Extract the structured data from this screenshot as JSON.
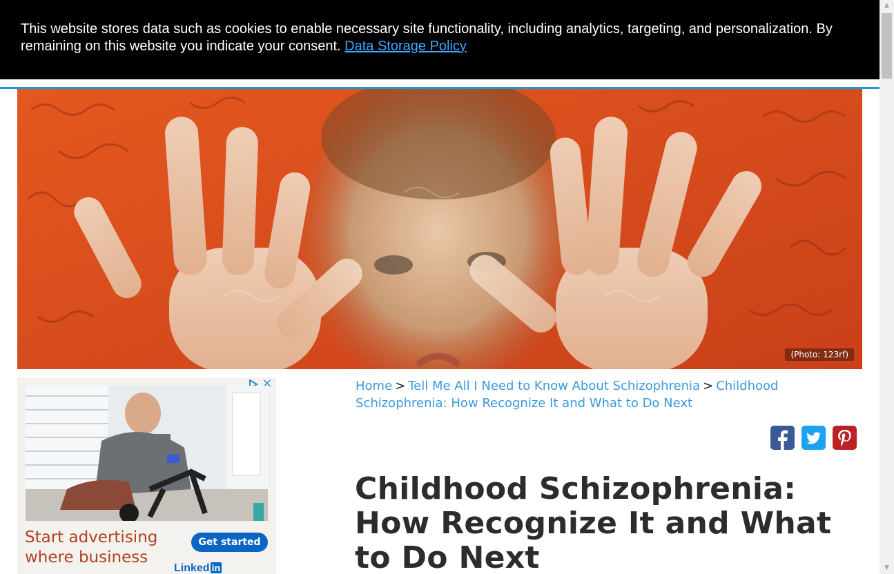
{
  "cookie_banner": {
    "text": "This website stores data such as cookies to enable necessary site functionality, including analytics, targeting, and personalization. By remaining on this website you indicate your consent.",
    "link_label": "Data Storage Policy"
  },
  "hero": {
    "photo_credit": "(Photo: 123rf)"
  },
  "ad": {
    "headline": "Start advertising where business",
    "cta_label": "Get started",
    "brand_name": "Linked",
    "brand_badge": "in",
    "close_icon": "×"
  },
  "breadcrumb": {
    "items": [
      {
        "label": "Home"
      },
      {
        "label": "Tell Me All I Need to Know About Schizophrenia"
      },
      {
        "label": "Childhood Schizophrenia: How Recognize It and What to Do Next"
      }
    ],
    "separator": ">"
  },
  "share": {
    "facebook_color": "#3b5998",
    "twitter_color": "#1da1f2",
    "pinterest_color": "#bd2126"
  },
  "article": {
    "title": "Childhood Schizophrenia: How Recognize It and What to Do Next"
  },
  "colors": {
    "link": "#3a9ad9",
    "accent_rule": "#2196d8"
  }
}
